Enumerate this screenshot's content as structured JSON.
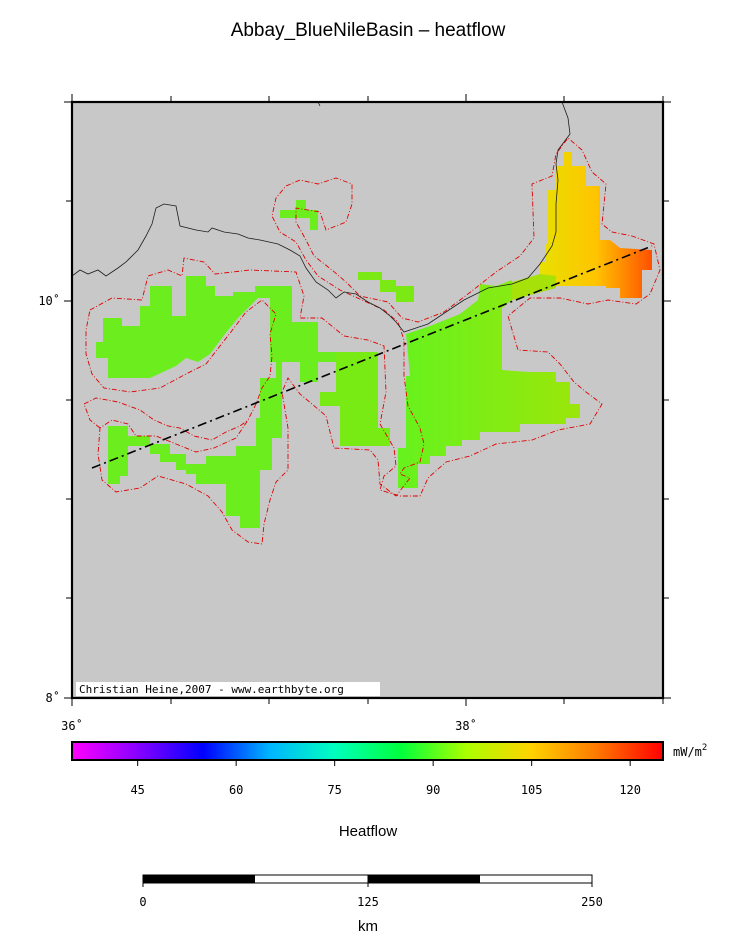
{
  "title": "Abbay_BlueNileBasin – heatflow",
  "map": {
    "lat_labels": [
      "10˚",
      "8˚"
    ],
    "lon_labels": [
      "36˚",
      "38˚"
    ],
    "credit": "Christian Heine,2007 - www.earthbyte.org",
    "background_color": "#c8c8c8",
    "basin_outline_color": "#e00000",
    "profile_line_color": "#000000"
  },
  "colorbar": {
    "label": "Heatflow",
    "unit_main": "mW/m",
    "unit_sup": "2",
    "ticks": [
      "45",
      "60",
      "75",
      "90",
      "105",
      "120"
    ],
    "range": [
      35,
      125
    ],
    "colors": [
      "#ff00ff",
      "#8800ff",
      "#0000ff",
      "#00b4ff",
      "#00ffbe",
      "#00ff3c",
      "#aaff00",
      "#ffd200",
      "#ff7800",
      "#ff0000"
    ]
  },
  "scalebar": {
    "label": "km",
    "ticks": [
      "0",
      "125",
      "250"
    ]
  }
}
